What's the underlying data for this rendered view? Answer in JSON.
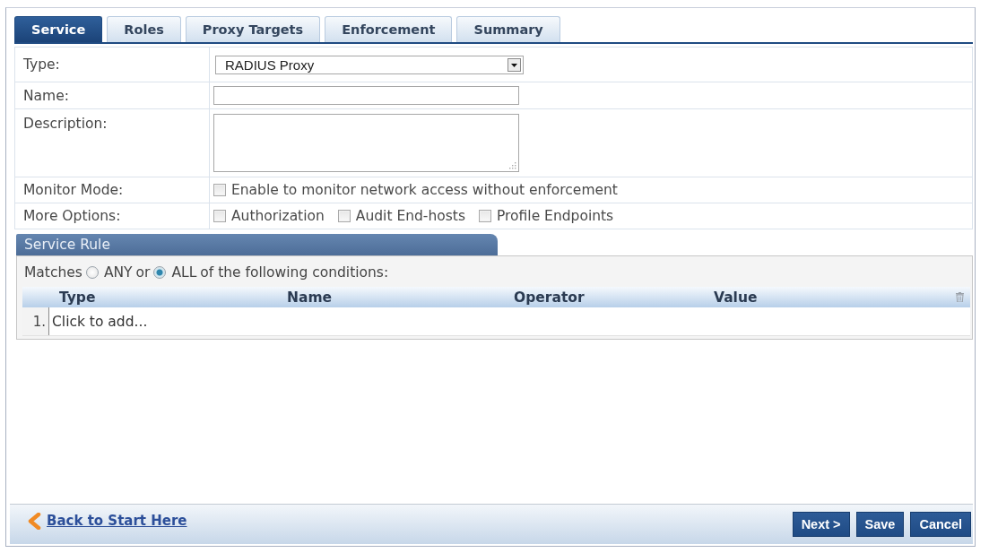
{
  "tabs": [
    {
      "label": "Service",
      "selected": true
    },
    {
      "label": "Roles",
      "selected": false
    },
    {
      "label": "Proxy Targets",
      "selected": false
    },
    {
      "label": "Enforcement",
      "selected": false
    },
    {
      "label": "Summary",
      "selected": false
    }
  ],
  "form": [
    {
      "kind": "select",
      "label": "Type:",
      "value": "RADIUS Proxy"
    },
    {
      "kind": "text",
      "label": "Name:"
    },
    {
      "kind": "textarea",
      "label": "Description:"
    },
    {
      "kind": "checkboxes",
      "label": "Monitor Mode:",
      "options": [
        {
          "label": "Enable to monitor network access without enforcement",
          "checked": false
        }
      ]
    },
    {
      "kind": "checkboxes",
      "label": "More Options:",
      "options": [
        {
          "label": "Authorization",
          "checked": false
        },
        {
          "label": "Audit End-hosts",
          "checked": false
        },
        {
          "label": "Profile Endpoints",
          "checked": false
        }
      ]
    }
  ],
  "service_rule": {
    "title": "Service Rule",
    "match": {
      "prefix": "Matches",
      "options": [
        {
          "label": "ANY",
          "selected": false
        },
        {
          "label": "ALL",
          "selected": true
        }
      ],
      "joiner": "or",
      "suffix": "of the following conditions:"
    },
    "columns": [
      "Type",
      "Name",
      "Operator",
      "Value"
    ],
    "rows": [
      {
        "number": "1.",
        "text": "Click to add..."
      }
    ]
  },
  "footer": {
    "back_link": "Back to Start Here",
    "buttons": [
      "Next >",
      "Save",
      "Cancel"
    ]
  }
}
